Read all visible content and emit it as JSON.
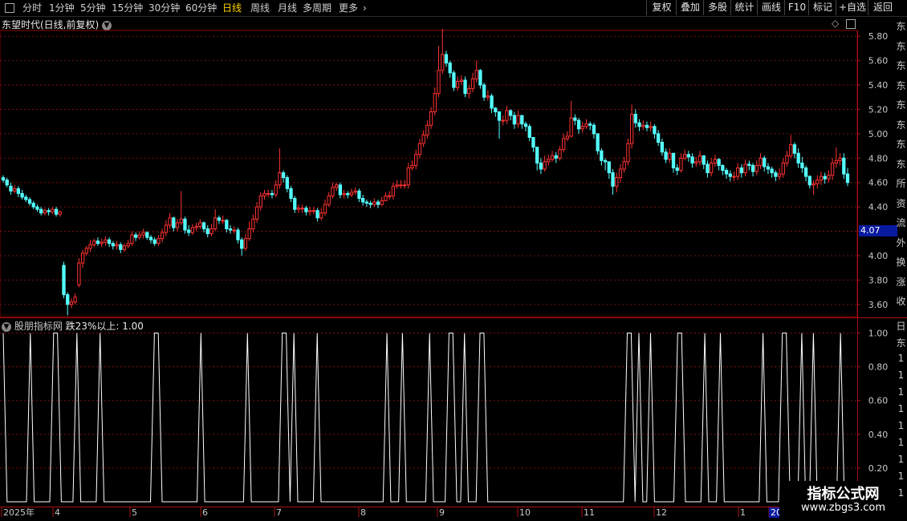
{
  "toolbar": {
    "periods": [
      "分时",
      "1分钟",
      "5分钟",
      "15分钟",
      "30分钟",
      "60分钟",
      "日线",
      "周线",
      "月线",
      "多周期",
      "更多"
    ],
    "active_period": "日线",
    "right_buttons": [
      "复权",
      "叠加",
      "多股",
      "统计",
      "画线",
      "F10",
      "标记",
      "+自选",
      "返回"
    ]
  },
  "main_header": {
    "title": "东望时代(日线,前复权)"
  },
  "sub_header": {
    "title": "股朋指标网",
    "indicator": "跌23%以上: 1.00"
  },
  "price_tag": "4.07",
  "side_texts": [
    "东",
    "东",
    "东",
    "东",
    "东",
    "东",
    "东",
    "东",
    "所",
    "资",
    "流",
    "外",
    "换",
    "涨",
    "收"
  ],
  "side_texts2": [
    "日",
    "东",
    "1",
    "1",
    "1",
    "1",
    "1",
    "1",
    "1",
    "1",
    "1"
  ],
  "watermark": {
    "line1": "指标公式网",
    "line2": "www.zbgs3.com"
  },
  "colors": {
    "up": "#ff3232",
    "down": "#54ffff",
    "grid": "#7a1010",
    "axis_text": "#c8c8c8",
    "indicator": "#ffffff"
  },
  "chart_data": [
    {
      "type": "candlestick",
      "title": "东望时代(日线,前复权)",
      "ylim": [
        3.5,
        5.9
      ],
      "yticks": [
        "3.60",
        "3.80",
        "4.00",
        "4.20",
        "4.40",
        "4.60",
        "4.80",
        "5.00",
        "5.20",
        "5.40",
        "5.60",
        "5.80"
      ],
      "grid": true,
      "xlabels": [
        "2025年",
        "4",
        "5",
        "6",
        "7",
        "8",
        "9",
        "10",
        "11",
        "12",
        "1",
        "20"
      ],
      "close": [
        4.62,
        4.58,
        4.53,
        4.55,
        4.51,
        4.48,
        4.46,
        4.43,
        4.4,
        4.38,
        4.35,
        4.37,
        4.36,
        4.38,
        4.34,
        4.36,
        3.68,
        3.6,
        3.62,
        3.66,
        3.94,
        4.02,
        4.06,
        4.09,
        4.12,
        4.1,
        4.11,
        4.13,
        4.1,
        4.08,
        4.09,
        4.05,
        4.08,
        4.1,
        4.17,
        4.15,
        4.17,
        4.19,
        4.15,
        4.13,
        4.1,
        4.14,
        4.19,
        4.25,
        4.31,
        4.23,
        4.27,
        4.3,
        4.21,
        4.19,
        4.23,
        4.24,
        4.27,
        4.22,
        4.18,
        4.22,
        4.31,
        4.29,
        4.29,
        4.22,
        4.21,
        4.21,
        4.13,
        4.06,
        4.14,
        4.22,
        4.3,
        4.4,
        4.49,
        4.51,
        4.51,
        4.5,
        4.58,
        4.68,
        4.64,
        4.55,
        4.47,
        4.38,
        4.39,
        4.39,
        4.36,
        4.37,
        4.37,
        4.31,
        4.35,
        4.42,
        4.49,
        4.56,
        4.58,
        4.5,
        4.51,
        4.5,
        4.52,
        4.53,
        4.47,
        4.44,
        4.43,
        4.42,
        4.44,
        4.42,
        4.45,
        4.49,
        4.49,
        4.57,
        4.58,
        4.58,
        4.58,
        4.72,
        4.74,
        4.83,
        4.92,
        4.99,
        5.07,
        5.18,
        5.33,
        5.52,
        5.65,
        5.58,
        5.5,
        5.38,
        5.43,
        5.44,
        5.33,
        5.37,
        5.45,
        5.52,
        5.4,
        5.3,
        5.31,
        5.21,
        5.18,
        5.11,
        5.11,
        5.19,
        5.15,
        5.08,
        5.15,
        5.08,
        5.06,
        4.97,
        4.89,
        4.76,
        4.71,
        4.77,
        4.79,
        4.82,
        4.8,
        4.87,
        4.96,
        4.98,
        5.13,
        5.11,
        5.04,
        5.06,
        5.08,
        5.07,
        5.0,
        4.86,
        4.78,
        4.77,
        4.68,
        4.57,
        4.64,
        4.71,
        4.77,
        4.92,
        5.16,
        5.09,
        5.06,
        5.07,
        5.05,
        5.06,
        5.0,
        4.93,
        4.85,
        4.79,
        4.84,
        4.72,
        4.7,
        4.8,
        4.83,
        4.81,
        4.76,
        4.77,
        4.82,
        4.75,
        4.68,
        4.76,
        4.79,
        4.74,
        4.7,
        4.67,
        4.65,
        4.65,
        4.72,
        4.68,
        4.75,
        4.74,
        4.69,
        4.74,
        4.8,
        4.73,
        4.71,
        4.68,
        4.65,
        4.67,
        4.76,
        4.82,
        4.91,
        4.84,
        4.76,
        4.72,
        4.65,
        4.58,
        4.59,
        4.62,
        4.65,
        4.63,
        4.66,
        4.76,
        4.78,
        4.8,
        4.67,
        4.6
      ],
      "open": [
        4.64,
        4.62,
        4.57,
        4.53,
        4.55,
        4.51,
        4.48,
        4.46,
        4.43,
        4.4,
        4.38,
        4.35,
        4.37,
        4.36,
        4.38,
        4.34,
        3.92,
        3.68,
        3.6,
        3.62,
        3.76,
        3.94,
        4.02,
        4.06,
        4.09,
        4.12,
        4.1,
        4.11,
        4.13,
        4.1,
        4.08,
        4.09,
        4.05,
        4.08,
        4.1,
        4.17,
        4.15,
        4.17,
        4.19,
        4.15,
        4.13,
        4.1,
        4.14,
        4.19,
        4.25,
        4.31,
        4.23,
        4.27,
        4.3,
        4.21,
        4.19,
        4.23,
        4.24,
        4.27,
        4.22,
        4.18,
        4.22,
        4.31,
        4.29,
        4.29,
        4.22,
        4.21,
        4.21,
        4.13,
        4.06,
        4.14,
        4.22,
        4.3,
        4.4,
        4.49,
        4.51,
        4.51,
        4.5,
        4.58,
        4.68,
        4.64,
        4.55,
        4.47,
        4.38,
        4.39,
        4.39,
        4.36,
        4.37,
        4.37,
        4.31,
        4.35,
        4.42,
        4.49,
        4.56,
        4.58,
        4.5,
        4.51,
        4.5,
        4.52,
        4.53,
        4.47,
        4.44,
        4.43,
        4.42,
        4.44,
        4.42,
        4.45,
        4.49,
        4.49,
        4.57,
        4.58,
        4.58,
        4.58,
        4.72,
        4.74,
        4.83,
        4.92,
        4.99,
        5.07,
        5.18,
        5.33,
        5.52,
        5.65,
        5.58,
        5.5,
        5.38,
        5.43,
        5.44,
        5.33,
        5.37,
        5.45,
        5.52,
        5.4,
        5.3,
        5.31,
        5.21,
        5.18,
        5.11,
        5.11,
        5.19,
        5.15,
        5.08,
        5.15,
        5.08,
        5.06,
        4.97,
        4.89,
        4.76,
        4.71,
        4.77,
        4.79,
        4.82,
        4.8,
        4.87,
        4.96,
        4.98,
        5.13,
        5.11,
        5.04,
        5.06,
        5.08,
        5.07,
        5.0,
        4.86,
        4.78,
        4.77,
        4.68,
        4.57,
        4.64,
        4.71,
        4.77,
        4.92,
        5.16,
        5.09,
        5.06,
        5.07,
        5.05,
        5.06,
        5.0,
        4.93,
        4.85,
        4.79,
        4.84,
        4.72,
        4.7,
        4.8,
        4.83,
        4.81,
        4.76,
        4.77,
        4.82,
        4.75,
        4.68,
        4.76,
        4.79,
        4.74,
        4.7,
        4.67,
        4.65,
        4.65,
        4.72,
        4.68,
        4.75,
        4.74,
        4.69,
        4.74,
        4.8,
        4.73,
        4.71,
        4.68,
        4.65,
        4.67,
        4.76,
        4.82,
        4.91,
        4.84,
        4.76,
        4.72,
        4.65,
        4.58,
        4.59,
        4.62,
        4.65,
        4.63,
        4.66,
        4.76,
        4.78,
        4.8,
        4.67
      ],
      "high": [
        4.66,
        4.64,
        4.6,
        4.58,
        4.57,
        4.54,
        4.5,
        4.48,
        4.45,
        4.42,
        4.4,
        4.39,
        4.39,
        4.4,
        4.4,
        4.37,
        3.95,
        3.7,
        3.65,
        3.69,
        3.98,
        4.05,
        4.08,
        4.13,
        4.14,
        4.15,
        4.14,
        4.16,
        4.15,
        4.12,
        4.12,
        4.11,
        4.1,
        4.13,
        4.2,
        4.19,
        4.2,
        4.22,
        4.2,
        4.17,
        4.15,
        4.17,
        4.22,
        4.29,
        4.35,
        4.32,
        4.3,
        4.53,
        4.32,
        4.25,
        4.26,
        4.27,
        4.3,
        4.28,
        4.25,
        4.26,
        4.38,
        4.33,
        4.33,
        4.3,
        4.25,
        4.24,
        4.23,
        4.15,
        4.18,
        4.28,
        4.34,
        4.44,
        4.52,
        4.54,
        4.54,
        4.54,
        4.62,
        4.88,
        4.7,
        4.66,
        4.57,
        4.49,
        4.42,
        4.42,
        4.41,
        4.4,
        4.4,
        4.39,
        4.39,
        4.46,
        4.52,
        4.6,
        4.6,
        4.6,
        4.54,
        4.53,
        4.55,
        4.56,
        4.55,
        4.5,
        4.46,
        4.45,
        4.47,
        4.46,
        4.48,
        4.52,
        4.53,
        4.6,
        4.62,
        4.62,
        4.62,
        4.76,
        4.78,
        4.87,
        4.96,
        5.03,
        5.11,
        5.22,
        5.38,
        5.72,
        5.86,
        5.68,
        5.6,
        5.52,
        5.47,
        5.48,
        5.47,
        5.4,
        5.5,
        5.6,
        5.53,
        5.42,
        5.36,
        5.33,
        5.22,
        5.16,
        5.15,
        5.23,
        5.2,
        5.18,
        5.19,
        5.12,
        5.1,
        5.08,
        4.93,
        4.86,
        4.8,
        4.82,
        4.83,
        4.86,
        4.85,
        4.9,
        5.0,
        5.02,
        5.27,
        5.16,
        5.13,
        5.1,
        5.12,
        5.1,
        5.09,
        4.95,
        4.88,
        4.8,
        4.76,
        4.71,
        4.68,
        4.75,
        4.81,
        4.96,
        5.24,
        5.2,
        5.12,
        5.11,
        5.1,
        5.1,
        5.08,
        5.03,
        4.96,
        4.88,
        4.88,
        4.84,
        4.75,
        4.84,
        4.87,
        4.86,
        4.84,
        4.81,
        4.86,
        4.82,
        4.78,
        4.8,
        4.83,
        4.8,
        4.75,
        4.72,
        4.7,
        4.69,
        4.76,
        4.75,
        4.79,
        4.78,
        4.76,
        4.78,
        4.84,
        4.82,
        4.76,
        4.73,
        4.7,
        4.72,
        4.8,
        4.86,
        4.99,
        4.93,
        4.88,
        4.81,
        4.74,
        4.66,
        4.62,
        4.66,
        4.69,
        4.68,
        4.7,
        4.8,
        4.89,
        4.84,
        4.84,
        4.72
      ],
      "low": [
        4.6,
        4.56,
        4.5,
        4.51,
        4.48,
        4.46,
        4.44,
        4.41,
        4.38,
        4.36,
        4.33,
        4.33,
        4.33,
        4.34,
        4.32,
        4.32,
        3.65,
        3.51,
        3.57,
        3.6,
        3.74,
        3.9,
        4.0,
        4.03,
        4.07,
        4.08,
        4.07,
        4.08,
        4.07,
        4.05,
        4.05,
        4.02,
        4.03,
        4.06,
        4.08,
        4.12,
        4.13,
        4.14,
        4.13,
        4.1,
        4.08,
        4.08,
        4.11,
        4.16,
        4.22,
        4.2,
        4.2,
        4.25,
        4.18,
        4.16,
        4.17,
        4.2,
        4.22,
        4.19,
        4.15,
        4.16,
        4.2,
        4.26,
        4.26,
        4.19,
        4.18,
        4.18,
        4.1,
        4.0,
        4.04,
        4.12,
        4.19,
        4.27,
        4.37,
        4.46,
        4.48,
        4.47,
        4.48,
        4.55,
        4.6,
        4.52,
        4.44,
        4.35,
        4.35,
        4.35,
        4.33,
        4.33,
        4.34,
        4.28,
        4.29,
        4.33,
        4.4,
        4.47,
        4.53,
        4.47,
        4.47,
        4.47,
        4.48,
        4.5,
        4.44,
        4.41,
        4.4,
        4.39,
        4.4,
        4.39,
        4.41,
        4.46,
        4.46,
        4.46,
        4.55,
        4.55,
        4.55,
        4.55,
        4.7,
        4.71,
        4.8,
        4.89,
        4.96,
        5.04,
        5.15,
        5.3,
        5.49,
        5.55,
        5.46,
        5.35,
        5.35,
        5.4,
        5.3,
        5.29,
        5.34,
        5.42,
        5.37,
        5.27,
        5.27,
        5.17,
        5.14,
        4.96,
        5.07,
        5.08,
        5.11,
        5.04,
        5.05,
        5.04,
        5.02,
        4.94,
        4.85,
        4.7,
        4.67,
        4.69,
        4.74,
        4.77,
        4.76,
        4.78,
        4.85,
        4.94,
        4.97,
        5.07,
        5.0,
        5.01,
        5.04,
        5.03,
        4.96,
        4.83,
        4.74,
        4.7,
        4.63,
        4.5,
        4.52,
        4.6,
        4.68,
        4.74,
        4.88,
        5.05,
        5.02,
        5.03,
        5.02,
        5.02,
        4.96,
        4.9,
        4.82,
        4.76,
        4.76,
        4.68,
        4.66,
        4.68,
        4.78,
        4.77,
        4.72,
        4.73,
        4.74,
        4.71,
        4.64,
        4.65,
        4.73,
        4.7,
        4.66,
        4.63,
        4.61,
        4.61,
        4.62,
        4.64,
        4.65,
        4.7,
        4.65,
        4.66,
        4.71,
        4.69,
        4.67,
        4.64,
        4.61,
        4.62,
        4.64,
        4.73,
        4.8,
        4.8,
        4.72,
        4.68,
        4.61,
        4.55,
        4.5,
        4.55,
        4.58,
        4.59,
        4.6,
        4.62,
        4.72,
        4.74,
        4.63,
        4.57
      ]
    },
    {
      "type": "line",
      "title": "股朋指标网",
      "series": [
        {
          "name": "跌23%以上",
          "values": [
            1,
            0,
            0,
            0,
            0,
            0,
            0,
            1,
            0,
            0,
            0,
            0,
            0,
            1,
            1,
            0,
            0,
            0,
            0,
            1,
            0,
            0,
            0,
            0,
            0,
            1,
            0,
            0,
            0,
            0,
            0,
            0,
            0,
            0,
            0,
            0,
            0,
            0,
            0,
            1,
            1,
            0,
            0,
            0,
            0,
            0,
            0,
            0,
            0,
            0,
            0,
            1,
            0,
            0,
            0,
            0,
            0,
            0,
            0,
            0,
            0,
            0,
            0,
            1,
            0,
            0,
            0,
            0,
            0,
            0,
            0,
            0,
            1,
            1,
            0,
            1,
            0,
            0,
            0,
            0,
            0,
            1,
            0,
            0,
            0,
            0,
            0,
            0,
            0,
            0,
            0,
            0,
            0,
            0,
            0,
            0,
            0,
            0,
            0,
            1,
            0,
            0,
            0,
            1,
            0,
            0,
            0,
            0,
            0,
            0,
            1,
            0,
            0,
            0,
            0,
            1,
            1,
            0,
            0,
            1,
            0,
            0,
            0,
            1,
            1,
            0,
            0,
            0,
            0,
            0,
            0,
            0,
            0,
            0,
            0,
            0,
            0,
            0,
            0,
            0,
            0,
            0,
            0,
            0,
            0,
            0,
            0,
            0,
            0,
            0,
            0,
            0,
            0,
            0,
            0,
            0,
            0,
            0,
            0,
            0,
            0,
            1,
            1,
            0,
            1,
            0,
            0,
            1,
            0,
            0,
            0,
            0,
            0,
            0,
            1,
            1,
            0,
            0,
            0,
            0,
            0,
            1,
            0,
            0,
            0,
            1,
            0,
            0,
            0,
            0,
            0,
            0,
            0,
            0,
            0,
            0,
            1,
            0,
            0,
            0,
            0,
            1,
            1,
            0,
            0,
            0,
            1,
            0,
            0,
            1,
            0,
            0,
            0,
            0,
            0,
            0,
            1,
            0
          ]
        }
      ],
      "ylim": [
        0,
        1.05
      ],
      "yticks": [
        "0.20",
        "0.40",
        "0.60",
        "0.80",
        "1.00"
      ],
      "grid": true
    }
  ]
}
